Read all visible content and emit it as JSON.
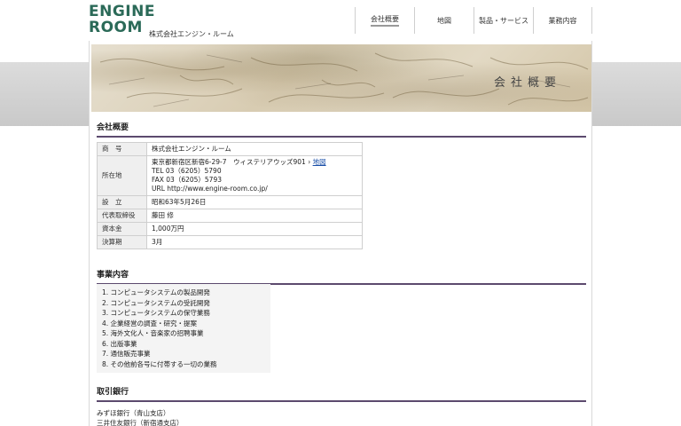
{
  "logo": {
    "line1": "ENGINE",
    "line2": "ROOM"
  },
  "company_small": "株式会社エンジン・ルーム",
  "nav": [
    {
      "label": "会社概要",
      "active": true
    },
    {
      "label": "地図",
      "active": false
    },
    {
      "label": "製品・サービス",
      "active": false
    },
    {
      "label": "業務内容",
      "active": false
    }
  ],
  "hero_title": "会社概要",
  "sections": {
    "overview": "会社概要",
    "business": "事業内容",
    "banks": "取引銀行"
  },
  "info_rows": {
    "name": {
      "label": "商　号",
      "value": "株式会社エンジン・ルーム"
    },
    "address": {
      "label": "所在地",
      "address_line": "東京都新宿区新宿6-29-7　ウィステリアウッズ901",
      "map_link": "地図",
      "tel": "TEL 03（6205）5790",
      "fax": "FAX 03（6205）5793",
      "url": "URL http://www.engine-room.co.jp/"
    },
    "founded": {
      "label": "設　立",
      "value": "昭和63年5月26日"
    },
    "ceo": {
      "label": "代表取締役",
      "value": "藤田 修"
    },
    "capital": {
      "label": "資本金",
      "value": "1,000万円"
    },
    "fiscal": {
      "label": "決算期",
      "value": "3月"
    }
  },
  "business_items": [
    "1. コンピュータシステムの製品開発",
    "2. コンピュータシステムの受託開発",
    "3. コンピュータシステムの保守業務",
    "4. 企業経営の調査・研究・提案",
    "5. 海外文化人・音楽家の招聘事業",
    "6. 出版事業",
    "7. 通信販売事業",
    "8. その他前各号に付帯する一切の業務"
  ],
  "banks": [
    "みずほ銀行（青山支店）",
    "三井住友銀行（新宿通支店）"
  ],
  "colors": {
    "logo_green": "#2b6a58",
    "section_rule": "#5c4a6e",
    "link": "#1a4fa8"
  }
}
